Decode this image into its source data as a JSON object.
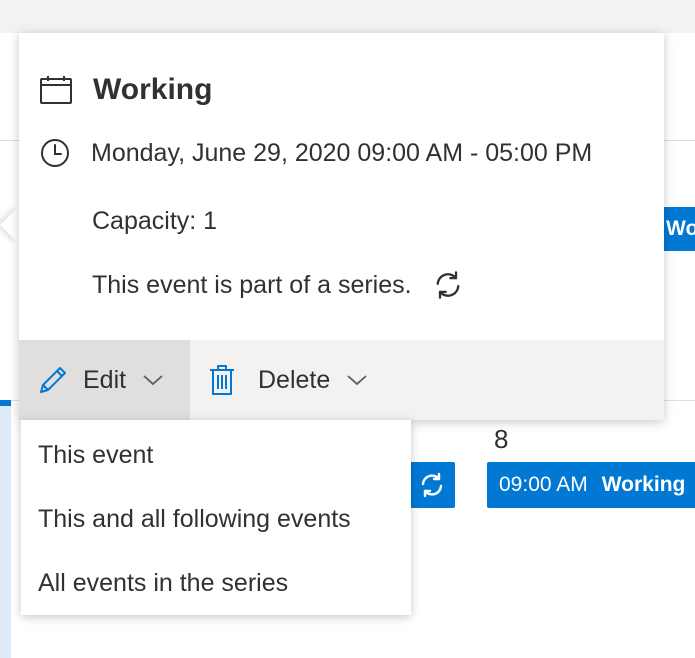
{
  "background": {
    "right_chip_label": "Workin",
    "day_number": "8",
    "event_chip_time": "09:00 AM",
    "event_chip_name": "Working"
  },
  "callout": {
    "title": "Working",
    "datetime": "Monday, June 29, 2020 09:00 AM - 05:00 PM",
    "capacity": "Capacity: 1",
    "series_note": "This event is part of a series.",
    "edit_label": "Edit",
    "delete_label": "Delete"
  },
  "edit_menu": {
    "items": [
      "This event",
      "This and all following events",
      "All events in the series"
    ]
  },
  "colors": {
    "accent": "#0078d4",
    "text": "#323130",
    "action_bar": "#f3f2f1",
    "edit_active": "#e1dfdd"
  }
}
